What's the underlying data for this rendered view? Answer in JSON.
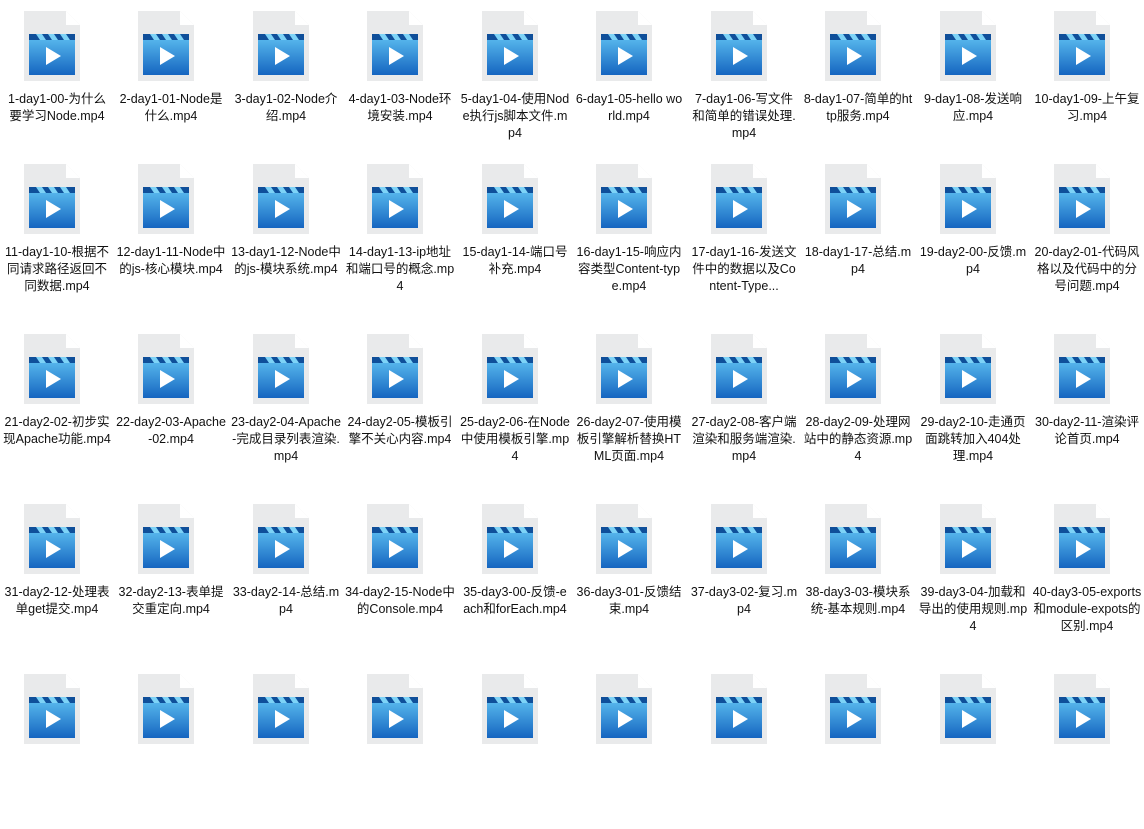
{
  "file_list": {
    "icon": "video-file-icon",
    "colors": {
      "page": "#e9eaeb",
      "fold": "#ffffff",
      "blue_top": "#5fc1f2",
      "blue_bottom": "#1565c0",
      "stripe_dark": "#0f4f9a",
      "stripe_light": "#7dd3f7",
      "play": "#ffffff"
    },
    "items": [
      {
        "label": "1-day1-00-为什么要学习Node.mp4"
      },
      {
        "label": "2-day1-01-Node是什么.mp4"
      },
      {
        "label": "3-day1-02-Node介绍.mp4"
      },
      {
        "label": "4-day1-03-Node环境安装.mp4"
      },
      {
        "label": "5-day1-04-使用Node执行js脚本文件.mp4"
      },
      {
        "label": "6-day1-05-hello world.mp4"
      },
      {
        "label": "7-day1-06-写文件和简单的错误处理.mp4"
      },
      {
        "label": "8-day1-07-简单的http服务.mp4"
      },
      {
        "label": "9-day1-08-发送响应.mp4"
      },
      {
        "label": "10-day1-09-上午复习.mp4"
      },
      {
        "label": "11-day1-10-根据不同请求路径返回不同数据.mp4"
      },
      {
        "label": "12-day1-11-Node中的js-核心模块.mp4"
      },
      {
        "label": "13-day1-12-Node中的js-模块系统.mp4"
      },
      {
        "label": "14-day1-13-ip地址和端口号的概念.mp4"
      },
      {
        "label": "15-day1-14-端口号补充.mp4"
      },
      {
        "label": "16-day1-15-响应内容类型Content-type.mp4"
      },
      {
        "label": "17-day1-16-发送文件中的数据以及Content-Type..."
      },
      {
        "label": "18-day1-17-总结.mp4"
      },
      {
        "label": "19-day2-00-反馈.mp4"
      },
      {
        "label": "20-day2-01-代码风格以及代码中的分号问题.mp4"
      },
      {
        "label": "21-day2-02-初步实现Apache功能.mp4"
      },
      {
        "label": "22-day2-03-Apache-02.mp4"
      },
      {
        "label": "23-day2-04-Apache-完成目录列表渲染.mp4"
      },
      {
        "label": "24-day2-05-模板引擎不关心内容.mp4"
      },
      {
        "label": "25-day2-06-在Node中使用模板引擎.mp4"
      },
      {
        "label": "26-day2-07-使用模板引擎解析替换HTML页面.mp4"
      },
      {
        "label": "27-day2-08-客户端渲染和服务端渲染.mp4"
      },
      {
        "label": "28-day2-09-处理网站中的静态资源.mp4"
      },
      {
        "label": "29-day2-10-走通页面跳转加入404处理.mp4"
      },
      {
        "label": "30-day2-11-渲染评论首页.mp4"
      },
      {
        "label": "31-day2-12-处理表单get提交.mp4"
      },
      {
        "label": "32-day2-13-表单提交重定向.mp4"
      },
      {
        "label": "33-day2-14-总结.mp4"
      },
      {
        "label": "34-day2-15-Node中的Console.mp4"
      },
      {
        "label": "35-day3-00-反馈-each和forEach.mp4"
      },
      {
        "label": "36-day3-01-反馈结束.mp4"
      },
      {
        "label": "37-day3-02-复习.mp4"
      },
      {
        "label": "38-day3-03-模块系统-基本规则.mp4"
      },
      {
        "label": "39-day3-04-加载和导出的使用规则.mp4"
      },
      {
        "label": "40-day3-05-exports和module-expots的区别.mp4"
      },
      {
        "label": ""
      },
      {
        "label": ""
      },
      {
        "label": ""
      },
      {
        "label": ""
      },
      {
        "label": ""
      },
      {
        "label": ""
      },
      {
        "label": ""
      },
      {
        "label": ""
      },
      {
        "label": ""
      },
      {
        "label": ""
      }
    ]
  }
}
